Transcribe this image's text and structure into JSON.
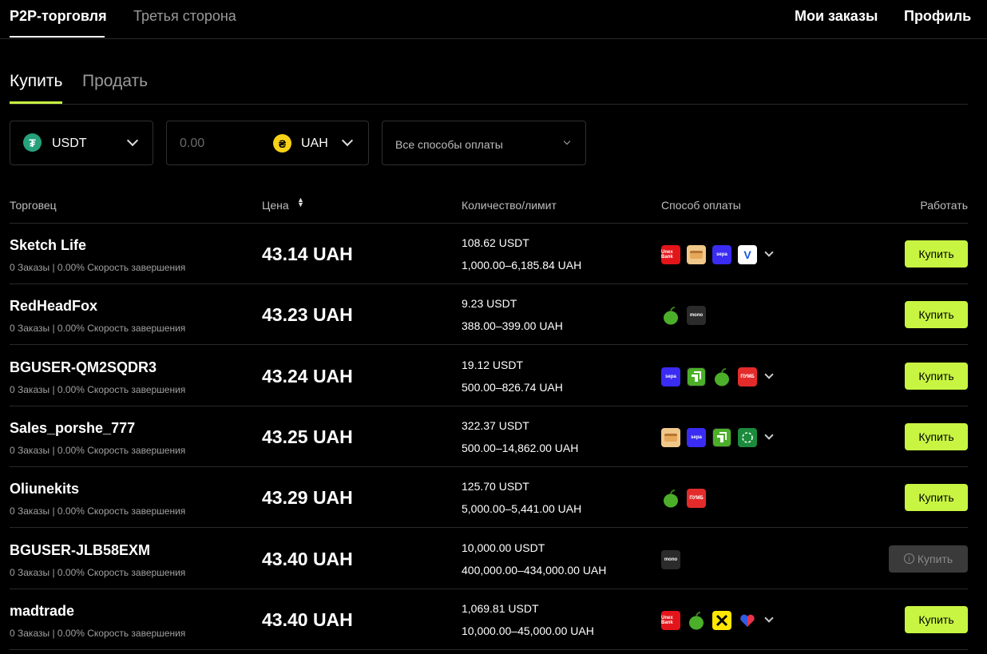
{
  "topnav": {
    "tab_p2p": "P2P-торговля",
    "tab_third": "Третья сторона",
    "my_orders": "Мои заказы",
    "profile": "Профиль"
  },
  "subtabs": {
    "buy": "Купить",
    "sell": "Продать"
  },
  "filters": {
    "crypto": "USDT",
    "amount_placeholder": "0.00",
    "fiat": "UAH",
    "payment": "Все способы оплаты"
  },
  "table": {
    "headers": {
      "merchant": "Торговец",
      "price": "Цена",
      "quantity": "Количество/лимит",
      "payment": "Способ оплаты",
      "action": "Работать"
    },
    "rows": [
      {
        "name": "Sketch Life",
        "stats": "0 Заказы | 0.00% Скорость завершения",
        "price": "43.14 UAH",
        "qty": "108.62 USDT",
        "limit": "1,000.00–6,185.84 UAH",
        "button": "Купить",
        "payments": [
          "unex-bank-icon",
          "card-icon",
          "sepa-icon",
          "v-icon"
        ],
        "more": true,
        "enabled": true
      },
      {
        "name": "RedHeadFox",
        "stats": "0 Заказы | 0.00% Скорость завершения",
        "price": "43.23 UAH",
        "qty": "9.23 USDT",
        "limit": "388.00–399.00 UAH",
        "button": "Купить",
        "payments": [
          "apple-icon",
          "mono-icon"
        ],
        "more": false,
        "enabled": true
      },
      {
        "name": "BGUSER-QM2SQDR3",
        "stats": "0 Заказы | 0.00% Скорость завершения",
        "price": "43.24 UAH",
        "qty": "19.12 USDT",
        "limit": "500.00–826.74 UAH",
        "button": "Купить",
        "payments": [
          "sepa-icon",
          "privat-icon",
          "apple-icon",
          "pumb-icon"
        ],
        "more": true,
        "enabled": true
      },
      {
        "name": "Sales_porshe_777",
        "stats": "0 Заказы | 0.00% Скорость завершения",
        "price": "43.25 UAH",
        "qty": "322.37 USDT",
        "limit": "500.00–14,862.00 UAH",
        "button": "Купить",
        "payments": [
          "card-icon",
          "sepa-icon",
          "privat-icon",
          "bank-green-icon"
        ],
        "more": true,
        "enabled": true
      },
      {
        "name": "Oliunekits",
        "stats": "0 Заказы | 0.00% Скорость завершения",
        "price": "43.29 UAH",
        "qty": "125.70 USDT",
        "limit": "5,000.00–5,441.00 UAH",
        "button": "Купить",
        "payments": [
          "apple-icon",
          "pumb-icon"
        ],
        "more": false,
        "enabled": true
      },
      {
        "name": "BGUSER-JLB58EXM",
        "stats": "0 Заказы | 0.00% Скорость завершения",
        "price": "43.40 UAH",
        "qty": "10,000.00 USDT",
        "limit": "400,000.00–434,000.00 UAH",
        "button": "Купить",
        "payments": [
          "mono-icon"
        ],
        "more": false,
        "enabled": false
      },
      {
        "name": "madtrade",
        "stats": "0 Заказы | 0.00% Скорость завершения",
        "price": "43.40 UAH",
        "qty": "1,069.81 USDT",
        "limit": "10,000.00–45,000.00 UAH",
        "button": "Купить",
        "payments": [
          "unex-bank-icon",
          "apple-icon",
          "raiffeisen-icon",
          "heart-icon"
        ],
        "more": true,
        "enabled": true
      }
    ]
  },
  "colors": {
    "accent": "#c8f542",
    "background": "#000000",
    "usdt": "#26a17b",
    "uah": "#f7d117"
  },
  "pay_labels": {
    "unex": "Unex Bank",
    "sepa": "sepa",
    "mono": "mono",
    "pumb": "ПУМБ",
    "v": "V"
  }
}
